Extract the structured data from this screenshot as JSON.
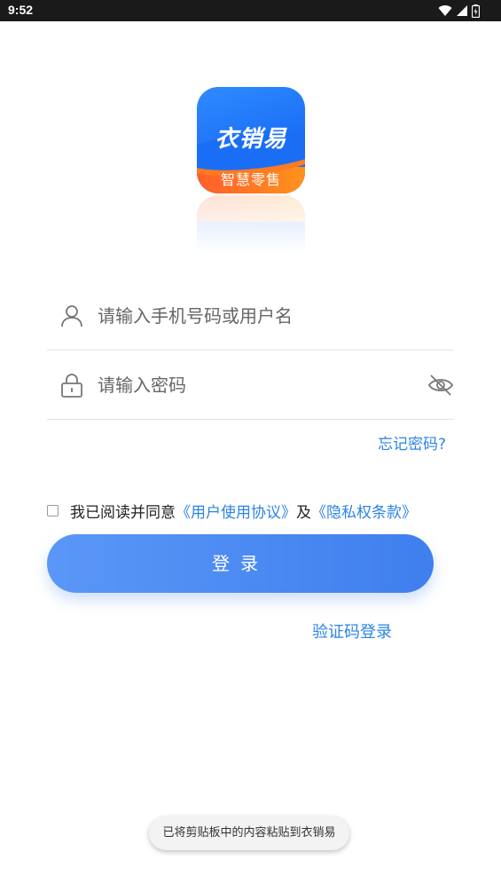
{
  "status_bar": {
    "time": "9:52",
    "icons": [
      "wifi-icon",
      "signal-icon",
      "battery-icon"
    ]
  },
  "logo": {
    "brand": "衣销易",
    "slogan": "智慧零售"
  },
  "form": {
    "username": {
      "placeholder": "请输入手机号码或用户名",
      "icon": "user-icon"
    },
    "password": {
      "placeholder": "请输入密码",
      "icon": "lock-icon",
      "toggle_icon": "eye-off-icon"
    },
    "forgot_password": "忘记密码?",
    "agreement": {
      "checked": false,
      "prefix": "我已阅读并同意",
      "terms_link": "《用户使用协议》",
      "joiner": "及",
      "privacy_link": "《隐私权条款》"
    },
    "login_button": "登录",
    "code_login_link": "验证码登录"
  },
  "toast": "已将剪贴板中的内容粘贴到衣销易",
  "colors": {
    "accent": "#2b84e6",
    "button_start": "#5a97f7",
    "button_end": "#3f7fee",
    "status_bar": "#1a1a1a"
  }
}
